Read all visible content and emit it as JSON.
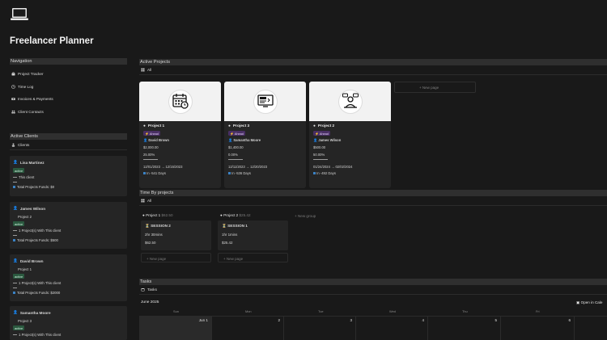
{
  "page": {
    "title": "Freelancer Planner",
    "icon": "laptop-icon"
  },
  "navigation": {
    "header": "Navigation",
    "items": [
      {
        "label": "Project Tracker",
        "icon": "briefcase-icon"
      },
      {
        "label": "Time Log",
        "icon": "clock-icon"
      },
      {
        "label": "Invoices & Payments",
        "icon": "money-icon"
      },
      {
        "label": "Client Contacts",
        "icon": "people-icon"
      }
    ]
  },
  "active_clients": {
    "header": "Active Clients",
    "view_label": "Clients",
    "cards": [
      {
        "name": "Lisa Martinez",
        "status": "active",
        "project": "",
        "projects_with": "This client",
        "funds": "Total Projects Funds: $0"
      },
      {
        "name": "James Wilson",
        "status": "active",
        "project": "Project 2",
        "projects_with": "1 Project(s) With This client",
        "funds": "Total Projects Funds: $500"
      },
      {
        "name": "David Brown",
        "status": "active",
        "project": "Project 1",
        "projects_with": "1 Project(s) With This client",
        "funds": "Total Projects Funds: $2000"
      },
      {
        "name": "Samantha Moore",
        "status": "active",
        "project": "Project 3",
        "projects_with": "1 Project(s) With This client",
        "funds": ""
      }
    ]
  },
  "active_projects": {
    "header": "Active Projects",
    "view_label": "All",
    "new_page_label": "New page",
    "cards": [
      {
        "title": "Project 1",
        "status": "Ahead",
        "client": "David Brown",
        "amount": "$2,000.00",
        "percent": "25.00%",
        "dates": "12/01/2023 → 12/15/2023",
        "days": "In -541 Days",
        "cover_icon": "calendar-icon"
      },
      {
        "title": "Project 3",
        "status": "Ahead",
        "client": "Samantha Moore",
        "amount": "$1,400.00",
        "percent": "0.00%",
        "dates": "12/11/2023 → 12/20/2023",
        "days": "In -536 Days",
        "cover_icon": "code-screen-icon"
      },
      {
        "title": "Project 2",
        "status": "Ahead",
        "client": "James Wilson",
        "amount": "$500.00",
        "percent": "50.00%",
        "dates": "01/24/2024 → 02/02/2024",
        "days": "In -492 Days",
        "cover_icon": "chat-person-icon"
      }
    ]
  },
  "time_by_projects": {
    "header": "Time By projects",
    "view_label": "All",
    "new_group_label": "New group",
    "new_page_label": "New page",
    "groups": [
      {
        "name": "Project 1",
        "total": "$62.50",
        "session": "SESSION 2",
        "duration": "2hr 30mins",
        "amount": "$62.50"
      },
      {
        "name": "Project 2",
        "total": "$25.42",
        "session": "SESSION 1",
        "duration": "1hr 1mins",
        "amount": "$25.42"
      }
    ]
  },
  "tasks": {
    "header": "Tasks",
    "view_label": "Tasks",
    "month": "June 2025",
    "open_in_calendar": "Open in Cale",
    "weekdays": [
      "Sun",
      "Mon",
      "Tue",
      "Wed",
      "Thu",
      "Fri",
      "Sat"
    ],
    "days": [
      "Jun 1",
      "2",
      "3",
      "4",
      "5",
      "6",
      ""
    ]
  }
}
